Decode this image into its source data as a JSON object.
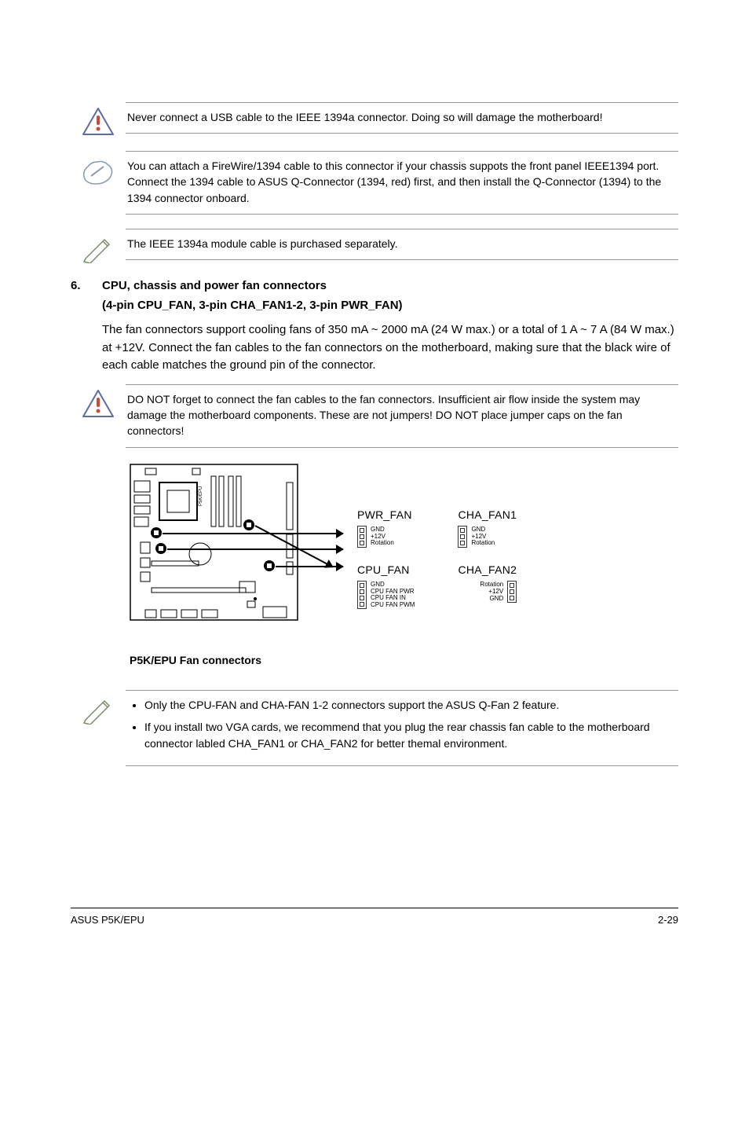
{
  "callouts": {
    "warn_usb": "Never connect a USB cable to the IEEE 1394a connector. Doing so will damage the motherboard!",
    "info_firewire": "You can attach a FireWire/1394 cable to this connector if your chassis suppots the front panel IEEE1394 port. Connect the 1394 cable to ASUS Q-Connector (1394, red) first, and then install the Q-Connector (1394) to the 1394 connector onboard.",
    "note_cable": "The IEEE 1394a module cable is purchased separately.",
    "warn_fan": "DO NOT forget to connect the fan cables to the fan connectors. Insufficient air flow inside the system may damage the motherboard components. These are not jumpers! DO NOT place jumper caps on the fan connectors!"
  },
  "section": {
    "num": "6.",
    "title": "CPU, chassis and power fan connectors",
    "subtitle": "(4-pin CPU_FAN, 3-pin CHA_FAN1-2, 3-pin PWR_FAN)",
    "para": "The fan connectors support cooling fans of 350 mA ~ 2000 mA (24 W max.) or a total of 1 A ~ 7 A (84 W max.) at +12V. Connect the fan cables to the fan connectors on the motherboard, making sure that the black wire of each cable matches the ground pin of the connector."
  },
  "diagram": {
    "caption": "P5K/EPU Fan connectors",
    "board_label": "P5K/EPU",
    "headers": {
      "pwr_fan": "PWR_FAN",
      "cpu_fan": "CPU_FAN",
      "cha_fan1": "CHA_FAN1",
      "cha_fan2": "CHA_FAN2"
    },
    "pins": {
      "pwr_fan": [
        "GND",
        "+12V",
        "Rotation"
      ],
      "cpu_fan": [
        "GND",
        "CPU FAN PWR",
        "CPU FAN IN",
        "CPU FAN PWM"
      ],
      "cha_fan1": [
        "GND",
        "+12V",
        "Rotation"
      ],
      "cha_fan2": [
        "Rotation",
        "+12V",
        "GND"
      ]
    }
  },
  "notes_list": {
    "item1": "Only the CPU-FAN and CHA-FAN 1-2 connectors support the ASUS Q-Fan 2 feature.",
    "item2": "If you install two VGA cards, we recommend that you plug the rear chassis fan cable to the motherboard connector labled CHA_FAN1 or CHA_FAN2 for better themal environment."
  },
  "footer": {
    "left": "ASUS P5K/EPU",
    "right": "2-29"
  }
}
